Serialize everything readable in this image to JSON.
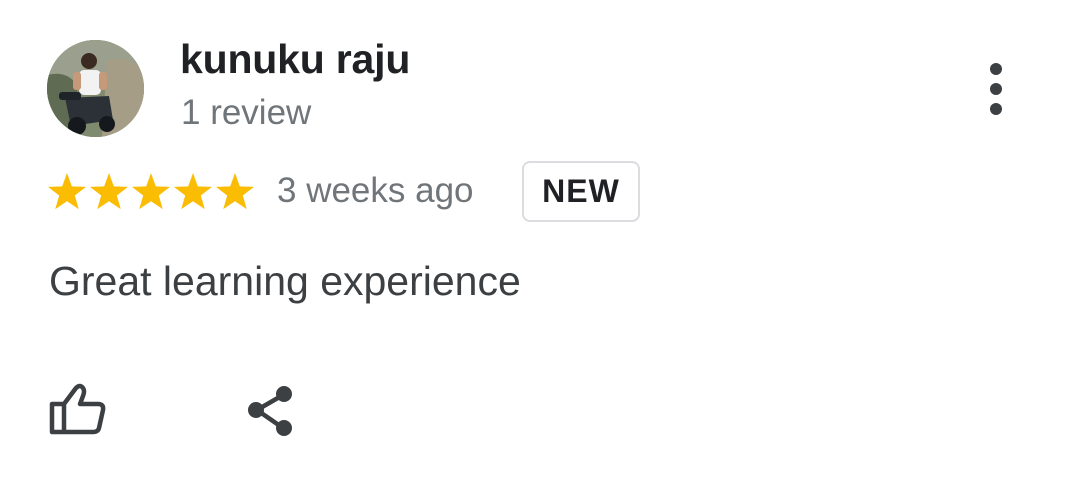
{
  "review": {
    "author_name": "kunuku raju",
    "author_review_count": "1 review",
    "rating": 5,
    "rating_max": 5,
    "time_ago": "3 weeks ago",
    "badge": "NEW",
    "text": "Great learning experience"
  },
  "icons": {
    "avatar": "profile-photo",
    "more": "more-vert-icon",
    "star": "star-icon",
    "like": "thumb-up-icon",
    "share": "share-icon"
  },
  "colors": {
    "star": "#fbbc04",
    "author": "#202124",
    "secondary": "#70757a",
    "body_text": "#3c4043",
    "badge_border": "#dadce0"
  }
}
